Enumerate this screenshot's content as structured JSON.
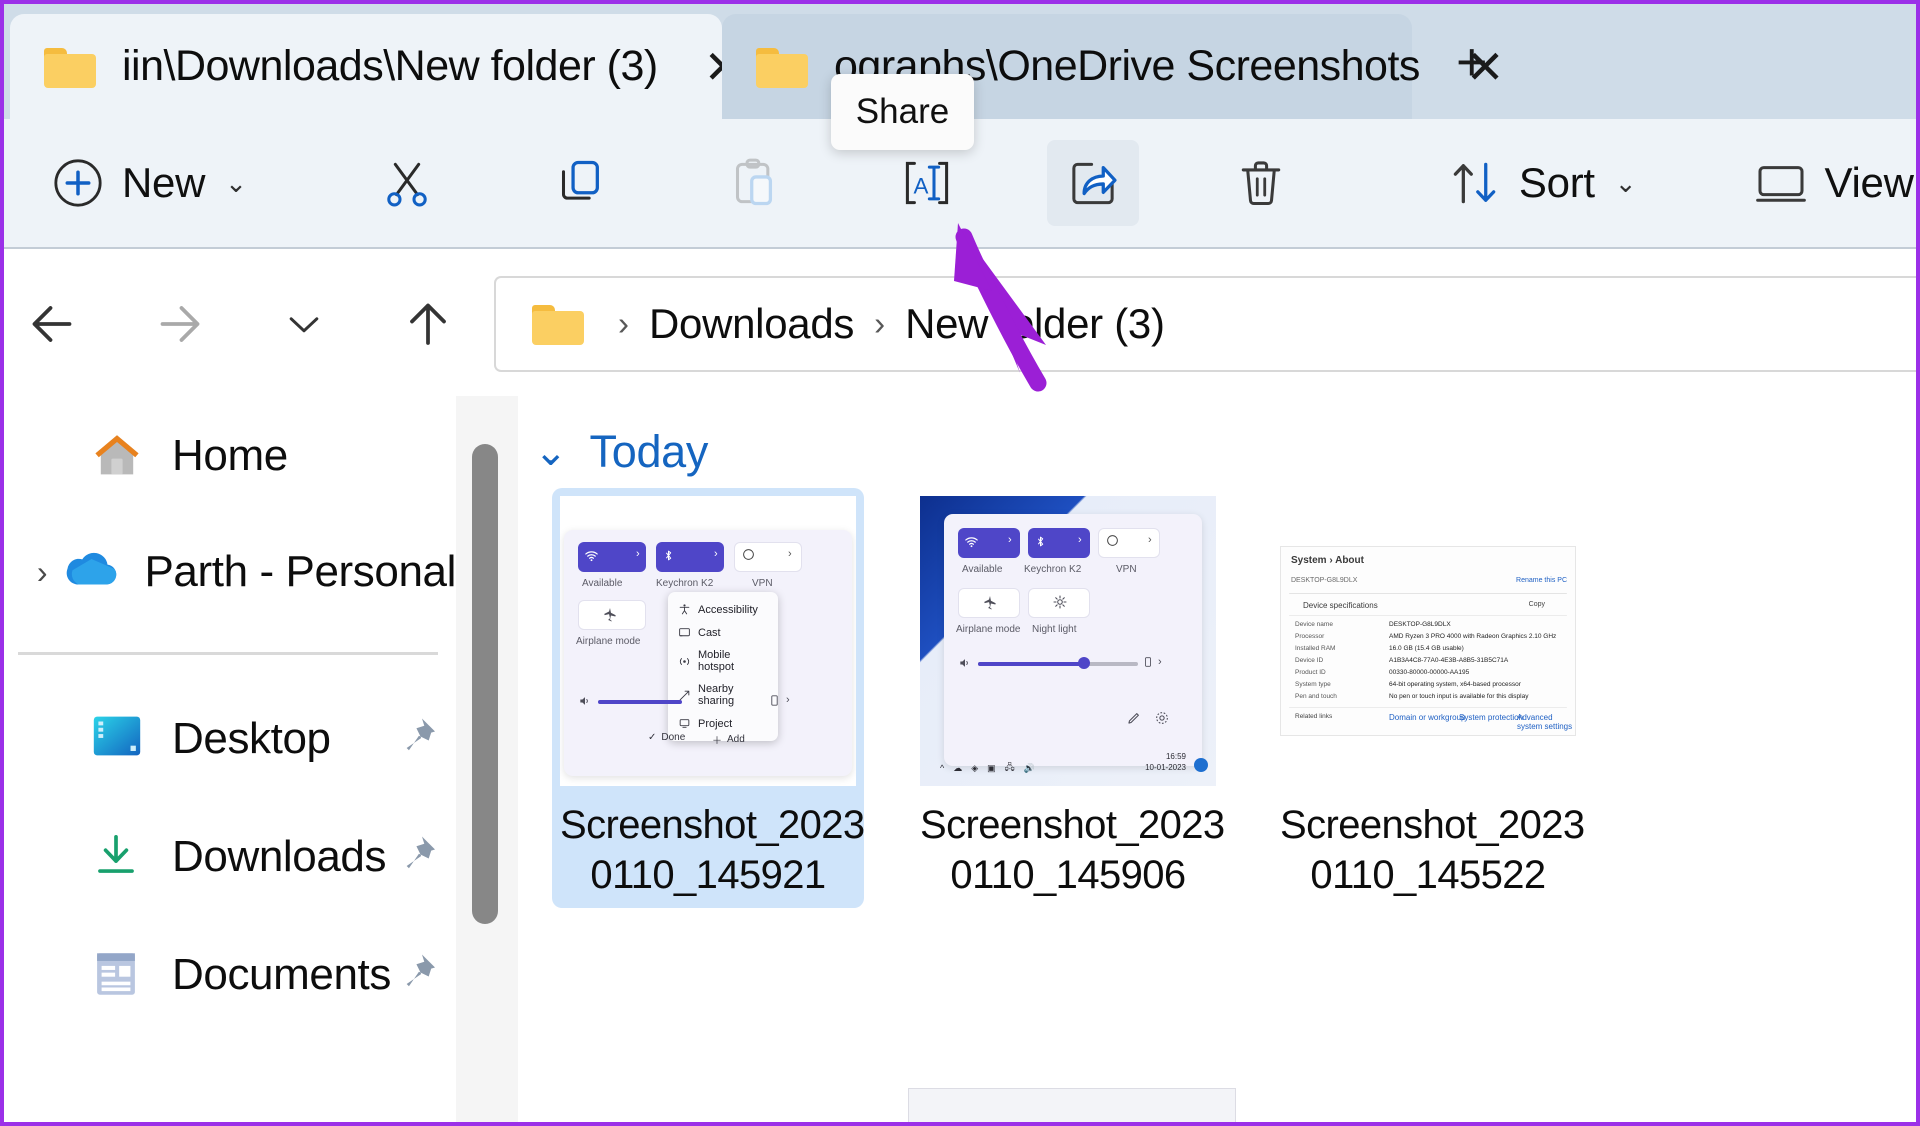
{
  "window": {
    "accent_border": "#9b30e8",
    "tabstrip_bg": "#cfdce8",
    "commandbar_bg": "#eef3f8"
  },
  "tabs": [
    {
      "title": "iin\\Downloads\\New folder (3)",
      "icon": "folder-icon",
      "close_label": "✕",
      "active": true
    },
    {
      "title": "ographs\\OneDrive Screenshots",
      "icon": "folder-icon",
      "close_label": "✕",
      "active": false
    }
  ],
  "new_tab_label": "+",
  "tooltip": {
    "text": "Share"
  },
  "toolbar": {
    "new_label": "New",
    "new_chevron": "⌄",
    "cut_name": "cut-icon",
    "copy_name": "copy-icon",
    "paste_name": "paste-icon",
    "rename_name": "rename-icon",
    "share_name": "share-icon",
    "delete_name": "delete-icon",
    "sort_label": "Sort",
    "sort_chevron": "⌄",
    "view_label": "View"
  },
  "nav": {
    "back": "←",
    "forward": "→",
    "recent_chevron": "⌄",
    "up": "↑"
  },
  "breadcrumb": {
    "root_icon": "folder-icon",
    "separator": "›",
    "items": [
      "Downloads",
      "New folder (3)"
    ]
  },
  "sidebar": {
    "items": [
      {
        "label": "Home",
        "icon": "home-icon",
        "expandable": false,
        "pinned": false
      },
      {
        "label": "Parth - Personal",
        "icon": "onedrive-icon",
        "expandable": true,
        "pinned": false
      },
      {
        "label": "Desktop",
        "icon": "desktop-icon",
        "expandable": false,
        "pinned": true
      },
      {
        "label": "Downloads",
        "icon": "download-icon",
        "expandable": false,
        "pinned": true
      },
      {
        "label": "Documents",
        "icon": "documents-icon",
        "expandable": false,
        "pinned": true
      }
    ],
    "expand_chevron": "›"
  },
  "content": {
    "group_label": "Today",
    "group_chevron": "⌄",
    "files": [
      {
        "name_line1": "Screenshot_2023",
        "name_line2": "0110_145921",
        "selected": true,
        "thumb": "quick-settings-menu"
      },
      {
        "name_line1": "Screenshot_2023",
        "name_line2": "0110_145906",
        "selected": false,
        "thumb": "quick-settings"
      },
      {
        "name_line1": "Screenshot_2023",
        "name_line2": "0110_145522",
        "selected": false,
        "thumb": "settings-about"
      }
    ]
  },
  "thumb1": {
    "tiles": [
      "Available",
      "Keychron K2",
      "VPN",
      "Airplane mode"
    ],
    "menu": [
      "Accessibility",
      "Cast",
      "Mobile hotspot",
      "Nearby sharing",
      "Project"
    ],
    "footer": {
      "done": "Done",
      "add": "Add"
    }
  },
  "thumb2": {
    "tiles": [
      "Available",
      "Keychron K2",
      "VPN",
      "Airplane mode",
      "Night light"
    ],
    "clock": "16:59",
    "date": "10-01-2023"
  },
  "thumb3": {
    "breadcrumb": "System  ›  About",
    "section": "Device specifications",
    "rows": [
      {
        "k": "Device name",
        "v": "DESKTOP-G8L9DLX"
      },
      {
        "k": "Processor",
        "v": "AMD Ryzen 3 PRO 4000 with Radeon Graphics  2.10 GHz"
      },
      {
        "k": "Installed RAM",
        "v": "16.0 GB (15.4 GB usable)"
      },
      {
        "k": "Device ID",
        "v": "A1B3A4C8-77A0-4E3B-A8B5-31B5C71A"
      },
      {
        "k": "Product ID",
        "v": "00330-80000-00000-AA195"
      },
      {
        "k": "System type",
        "v": "64-bit operating system, x64-based processor"
      },
      {
        "k": "Pen and touch",
        "v": "No pen or touch input is available for this display"
      }
    ],
    "related": "Related links",
    "links": [
      "Domain or workgroup",
      "System protection",
      "Advanced system settings"
    ],
    "copy": "Copy",
    "rename": "Rename this PC"
  },
  "annotation": {
    "arrow_color": "#9b1fd6"
  }
}
